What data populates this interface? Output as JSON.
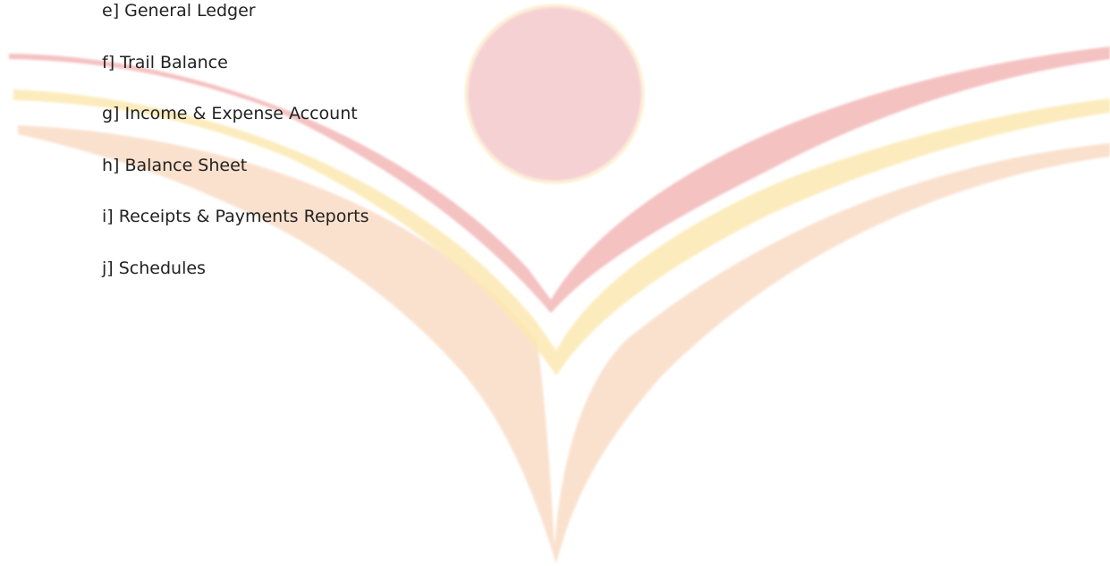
{
  "watermark": {
    "logo": "sunrise-v-logo-watermark",
    "colors": {
      "red": "#f2b3b5",
      "yellow": "#fbeab0",
      "orange": "#f8d9c2"
    }
  },
  "report_list": {
    "items": [
      {
        "label": "e] General Ledger"
      },
      {
        "label": "f] Trail Balance"
      },
      {
        "label": "g] Income & Expense Account"
      },
      {
        "label": "h] Balance Sheet"
      },
      {
        "label": "i] Receipts & Payments Reports"
      },
      {
        "label": "j] Schedules"
      }
    ]
  }
}
